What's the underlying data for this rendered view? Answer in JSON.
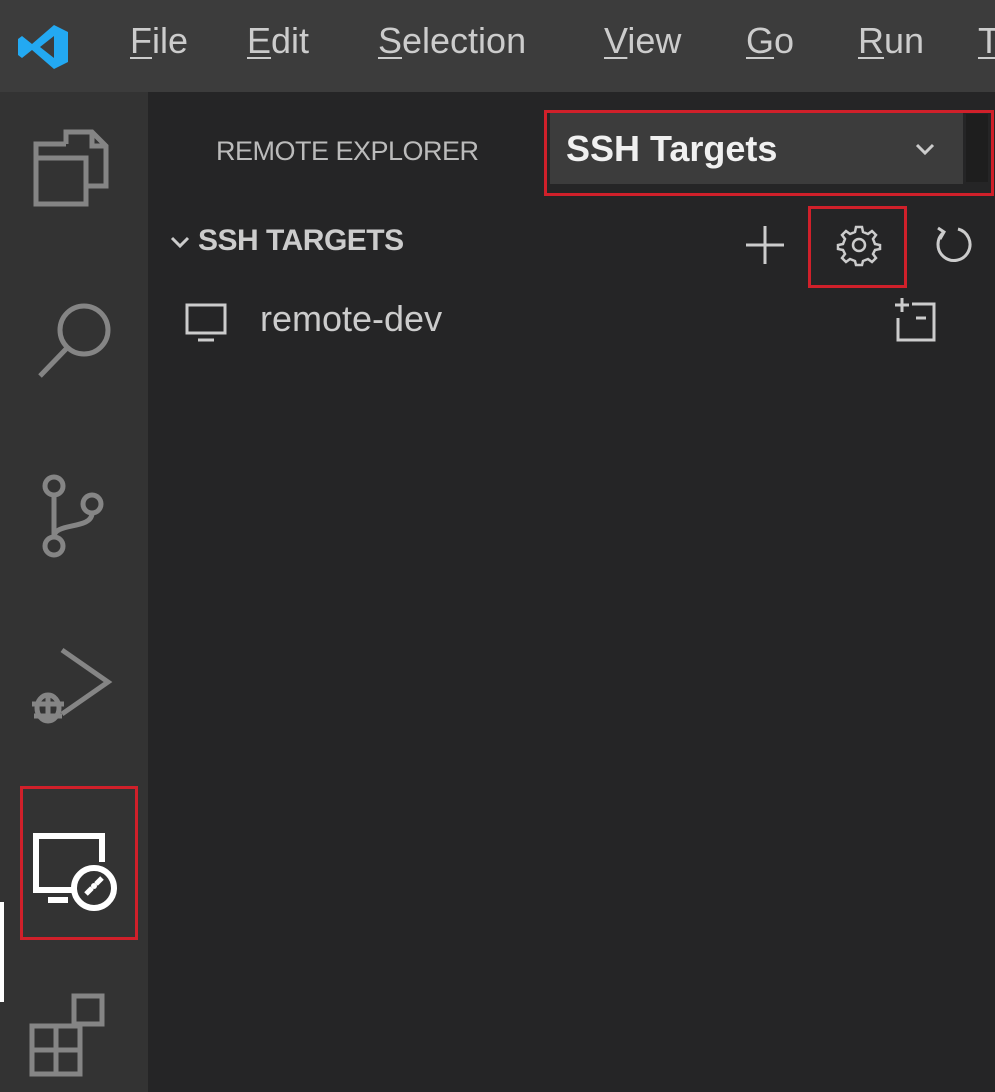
{
  "menubar": {
    "items": [
      {
        "mnemonic": "F",
        "rest": "ile"
      },
      {
        "mnemonic": "E",
        "rest": "dit"
      },
      {
        "mnemonic": "S",
        "rest": "election"
      },
      {
        "mnemonic": "V",
        "rest": "iew"
      },
      {
        "mnemonic": "G",
        "rest": "o"
      },
      {
        "mnemonic": "R",
        "rest": "un"
      },
      {
        "mnemonic": "T",
        "rest": ""
      }
    ]
  },
  "activitybar": {
    "items": [
      {
        "icon": "explorer-icon"
      },
      {
        "icon": "search-icon"
      },
      {
        "icon": "source-control-icon"
      },
      {
        "icon": "run-debug-icon"
      },
      {
        "icon": "remote-explorer-icon",
        "active": true
      },
      {
        "icon": "extensions-icon"
      }
    ]
  },
  "sidebar": {
    "header_title": "REMOTE EXPLORER",
    "view_select": {
      "value": "SSH Targets"
    },
    "section": {
      "title": "SSH TARGETS",
      "actions": [
        "add-icon",
        "gear-icon",
        "refresh-icon"
      ]
    },
    "targets": [
      {
        "label": "remote-dev",
        "icon": "monitor-icon",
        "action_icon": "open-new-window-icon"
      }
    ]
  },
  "colors": {
    "highlight": "#d0202a",
    "vscode_blue": "#23a9f2",
    "menubar_bg": "#3c3c3c",
    "activitybar_bg": "#333333",
    "sidebar_bg": "#252526"
  }
}
